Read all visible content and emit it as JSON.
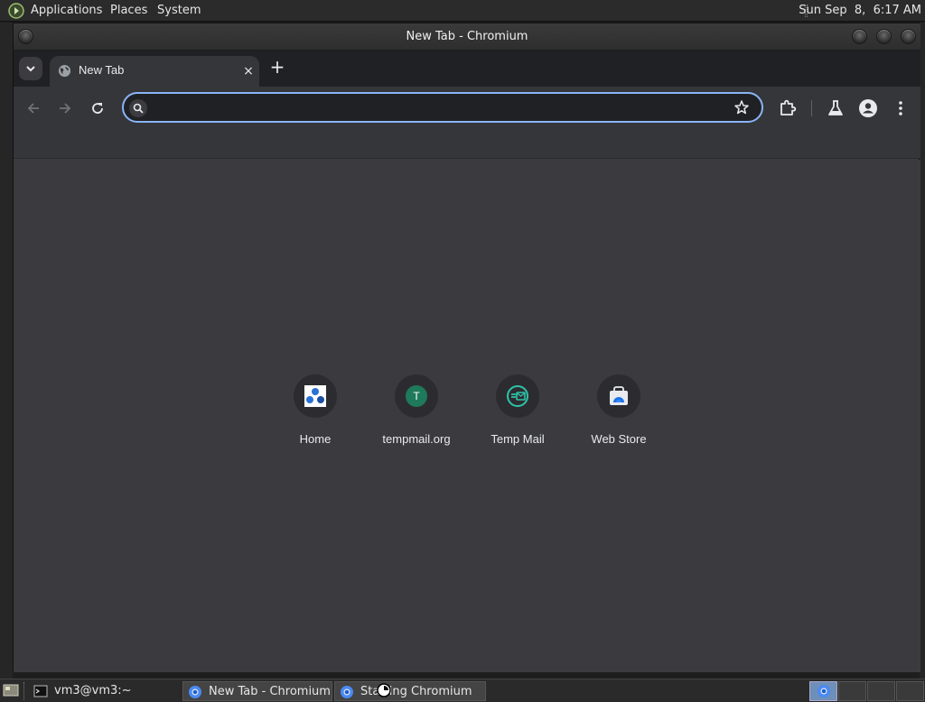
{
  "top_panel": {
    "menus": [
      "Applications",
      "Places",
      "System"
    ],
    "clock": "Sun Sep  8,  6:17 AM"
  },
  "window": {
    "title": "New Tab - Chromium"
  },
  "browser": {
    "tab": {
      "title": "New Tab",
      "close_glyph": "×"
    },
    "new_tab_glyph": "+",
    "omnibox": {
      "value": "",
      "placeholder": ""
    },
    "accent_color": "#8ab4f8"
  },
  "shortcuts": [
    {
      "label": "Home",
      "icon": "home-network-icon"
    },
    {
      "label": "tempmail.org",
      "icon": "letter-t-icon",
      "letter": "T"
    },
    {
      "label": "Temp Mail",
      "icon": "temp-mail-icon"
    },
    {
      "label": "Web Store",
      "icon": "web-store-icon"
    }
  ],
  "taskbar": {
    "tasks": [
      {
        "label": "vm3@vm3:~",
        "icon": "terminal-icon"
      },
      {
        "label": "New Tab - Chromium",
        "icon": "chromium-icon"
      },
      {
        "label": "Starting Chromium",
        "icon": "chromium-icon"
      }
    ]
  }
}
